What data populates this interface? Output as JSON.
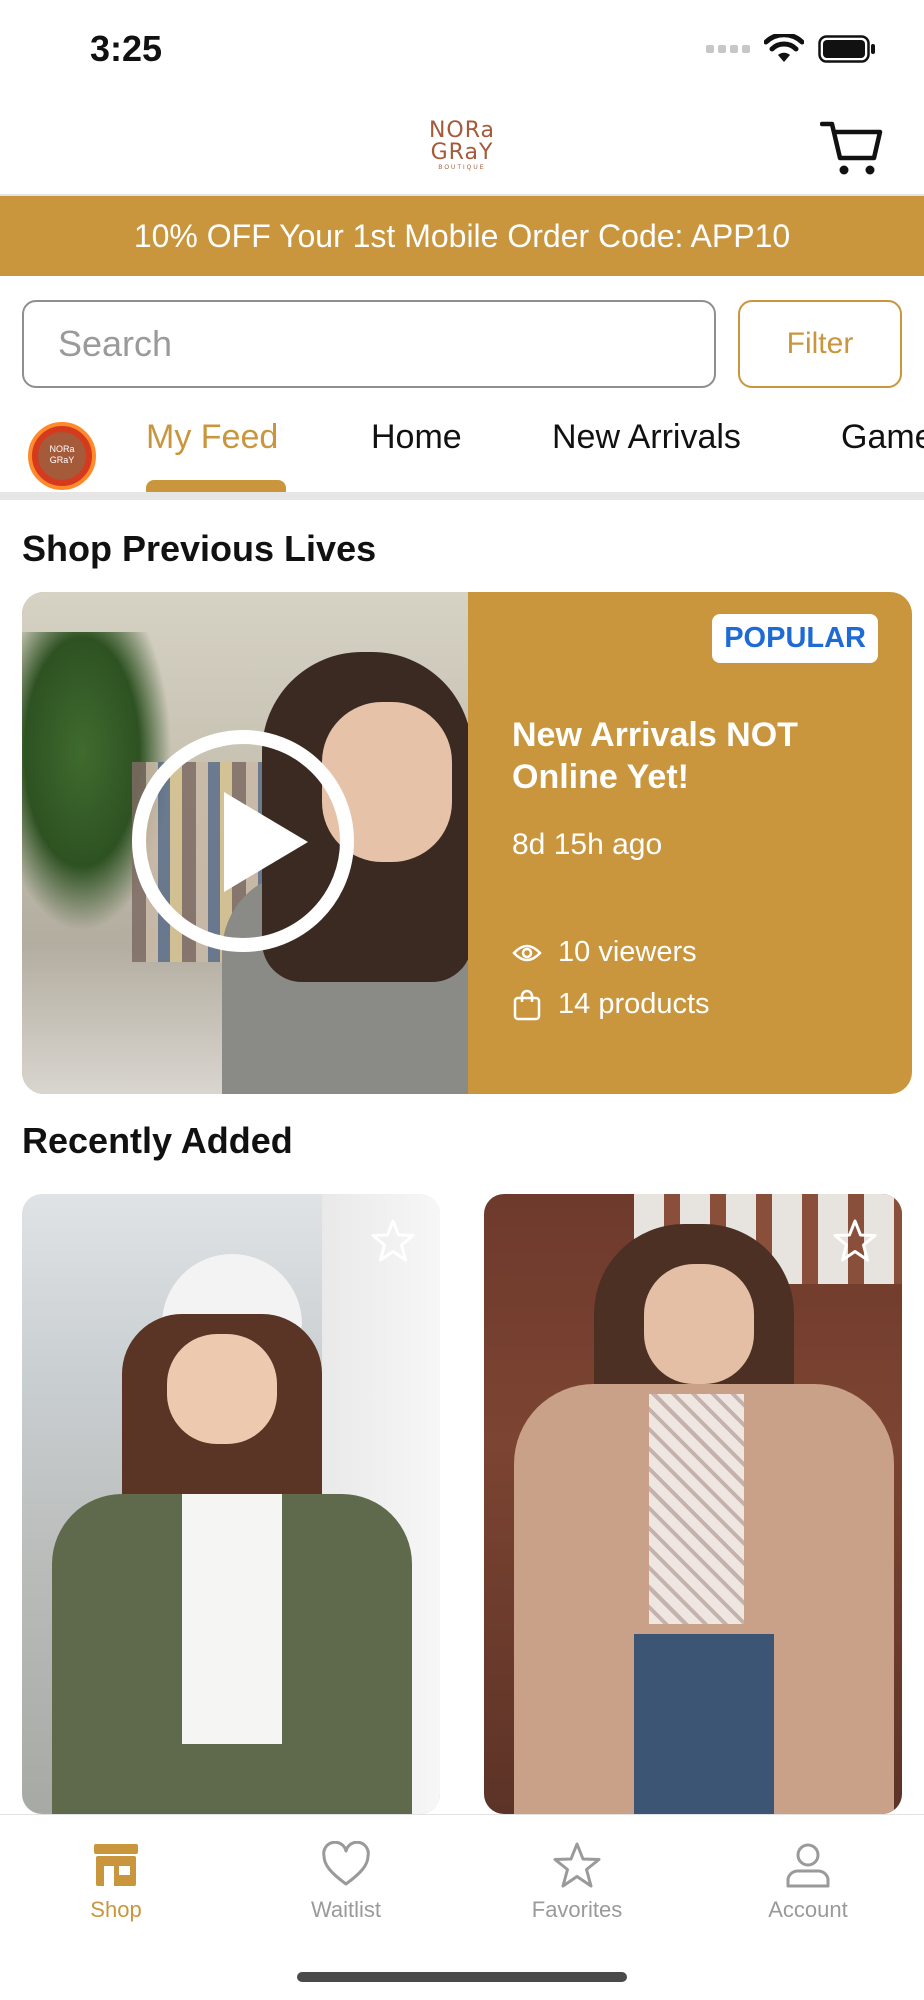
{
  "status_bar": {
    "time": "3:25"
  },
  "header": {
    "logo_line1": "NORa",
    "logo_line2": "GRaY",
    "logo_line3": "BOUTIQUE"
  },
  "promo": {
    "text": "10% OFF Your 1st Mobile Order Code: APP10"
  },
  "search": {
    "placeholder": "Search",
    "value": ""
  },
  "filter": {
    "label": "Filter"
  },
  "store_avatar": {
    "line1": "NORa",
    "line2": "GRaY"
  },
  "tabs": [
    {
      "label": "My Feed",
      "active": true
    },
    {
      "label": "Home",
      "active": false
    },
    {
      "label": "New Arrivals",
      "active": false
    },
    {
      "label": "Game",
      "active": false
    }
  ],
  "sections": {
    "previous_lives": "Shop Previous Lives",
    "recently_added": "Recently Added"
  },
  "live_card": {
    "badge": "POPULAR",
    "title": "New Arrivals NOT Online Yet!",
    "time_ago": "8d 15h ago",
    "viewers": "10 viewers",
    "products": "14 products"
  },
  "products": [
    {
      "name": "product-olive-jacket"
    },
    {
      "name": "product-tan-shacket"
    }
  ],
  "tab_bar": [
    {
      "label": "Shop",
      "icon": "store-icon",
      "active": true
    },
    {
      "label": "Waitlist",
      "icon": "heart-icon",
      "active": false
    },
    {
      "label": "Favorites",
      "icon": "star-icon",
      "active": false
    },
    {
      "label": "Account",
      "icon": "person-icon",
      "active": false
    }
  ],
  "colors": {
    "accent": "#c9963e",
    "badge_text": "#1e6bd6",
    "inactive": "#9a9a9a",
    "logo": "#a55a3a"
  }
}
